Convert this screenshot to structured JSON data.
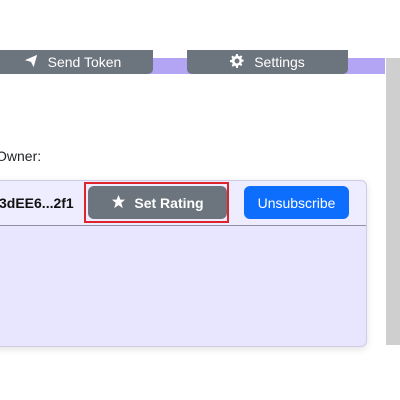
{
  "tabs": {
    "send_token_label": "Send Token",
    "settings_label": "Settings"
  },
  "owner": {
    "label": "Owner:"
  },
  "subscription": {
    "address": "3dEE6...2f1",
    "set_rating_label": "Set Rating",
    "unsubscribe_label": "Unsubscribe"
  },
  "icons": {
    "send": "paper-plane-icon",
    "settings": "gear-icon",
    "rating": "star-icon"
  },
  "colors": {
    "secondary_button": "#6c757d",
    "primary_button": "#0d6efd",
    "card_background": "#e8e6ff",
    "top_band": "#b3a5f3",
    "highlight": "#e0242b"
  }
}
